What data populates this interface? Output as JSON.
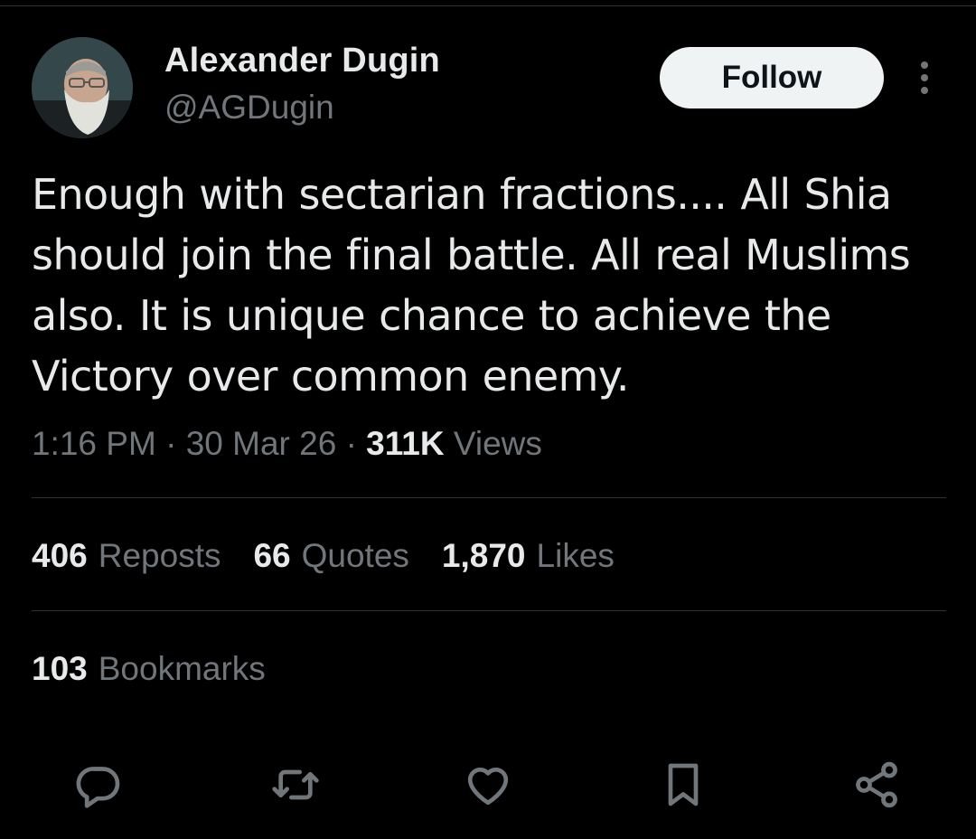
{
  "author": {
    "name": "Alexander Dugin",
    "handle": "@AGDugin",
    "avatar": "profile-photo"
  },
  "header": {
    "follow_label": "Follow",
    "more_icon": "more-vertical-icon"
  },
  "tweet": {
    "text": "Enough with sectarian fractions.... All Shia should join the final battle. All real Muslims also. It is unique chance to achieve the Victory over common enemy."
  },
  "meta": {
    "time": "1:16 PM",
    "sep1": "·",
    "date": "30 Mar 26",
    "sep2": "·",
    "views_count": "311K",
    "views_label": "Views"
  },
  "stats": {
    "reposts": {
      "count": "406",
      "label": "Reposts"
    },
    "quotes": {
      "count": "66",
      "label": "Quotes"
    },
    "likes": {
      "count": "1,870",
      "label": "Likes"
    },
    "bookmarks": {
      "count": "103",
      "label": "Bookmarks"
    }
  },
  "actions": [
    "reply-icon",
    "repost-icon",
    "like-icon",
    "bookmark-icon",
    "share-icon"
  ],
  "colors": {
    "background": "#000000",
    "text": "#e7e9ea",
    "muted": "#71767b",
    "divider": "#2f3336",
    "button_bg": "#eff3f4"
  }
}
